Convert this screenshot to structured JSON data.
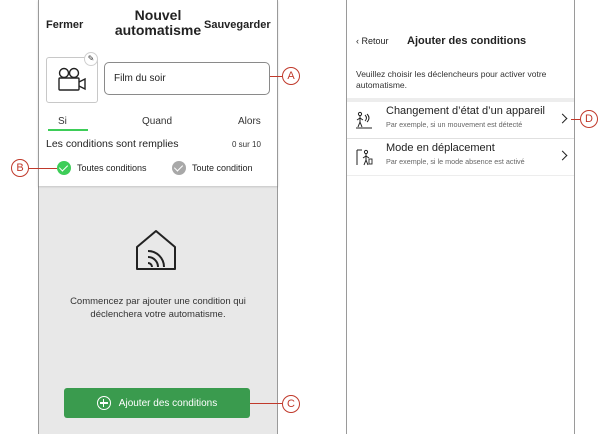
{
  "left": {
    "header": {
      "close_label": "Fermer",
      "title": "Nouvel automatisme",
      "save_label": "Sauvegarder"
    },
    "automation": {
      "icon": "film-camera-icon",
      "name_value": "Film du soir"
    },
    "tabs": [
      {
        "label": "Si",
        "active": true
      },
      {
        "label": "Quand",
        "active": false
      },
      {
        "label": "Alors",
        "active": false
      }
    ],
    "conditions": {
      "label": "Les conditions sont remplies",
      "count": "0 sur 10",
      "options": [
        {
          "label": "Toutes conditions",
          "selected": true
        },
        {
          "label": "Toute condition",
          "selected": false
        }
      ]
    },
    "empty_state": {
      "icon": "smart-home-icon",
      "text": "Commencez par ajouter une condition qui déclenchera votre automatisme."
    },
    "add_button_label": "Ajouter des conditions"
  },
  "right": {
    "back_label": "Retour",
    "title": "Ajouter des conditions",
    "instructions": "Veuillez choisir les déclencheurs pour activer votre automatisme.",
    "choices": [
      {
        "icon": "device-state-icon",
        "title": "Changement d’état d’un appareil",
        "subtitle": "Par exemple, si un mouvement est détecté"
      },
      {
        "icon": "travel-mode-icon",
        "title": "Mode en déplacement",
        "subtitle": "Par exemple, si le mode absence est activé"
      }
    ]
  },
  "callouts": {
    "a": "A",
    "b": "B",
    "c": "C",
    "d": "D"
  },
  "colors": {
    "accent_green": "#3dcd58",
    "button_green": "#3a9b4e",
    "callout_red": "#c0392b"
  }
}
